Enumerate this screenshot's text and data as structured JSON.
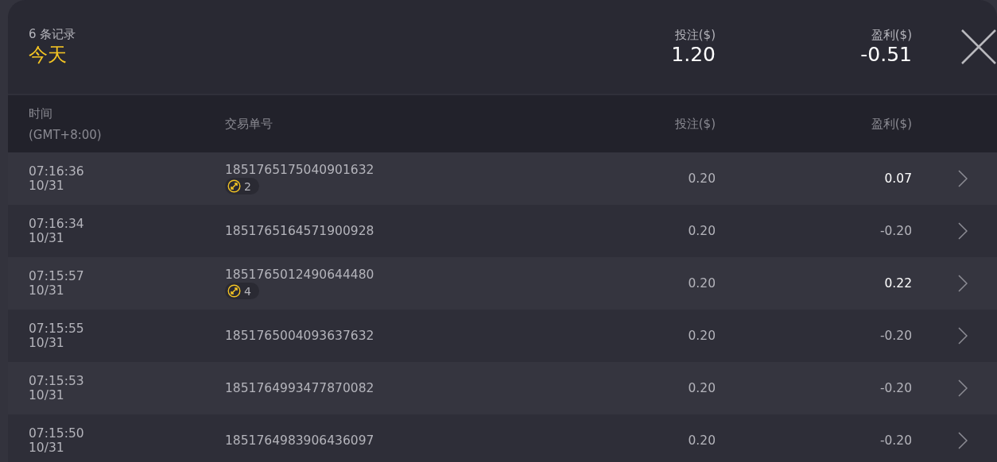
{
  "summary": {
    "count": "6 条记录",
    "period": "今天",
    "bet_label": "投注($)",
    "bet_total": "1.20",
    "profit_label": "盈利($)",
    "profit_total": "-0.51"
  },
  "table": {
    "columns": [
      {
        "label": "时间",
        "sub": "(GMT+8:00)"
      },
      {
        "label": "交易单号"
      },
      {
        "label": "投注($)"
      },
      {
        "label": "盈利($)"
      }
    ],
    "rows": [
      {
        "time": "07:16:36",
        "date": "10/31",
        "order": "1851765175040901632",
        "badge": "2",
        "bet": "0.20",
        "profit": "0.07",
        "positive": true
      },
      {
        "time": "07:16:34",
        "date": "10/31",
        "order": "1851765164571900928",
        "bet": "0.20",
        "profit": "-0.20",
        "positive": false
      },
      {
        "time": "07:15:57",
        "date": "10/31",
        "order": "1851765012490644480",
        "badge": "4",
        "bet": "0.20",
        "profit": "0.22",
        "positive": true
      },
      {
        "time": "07:15:55",
        "date": "10/31",
        "order": "1851765004093637632",
        "bet": "0.20",
        "profit": "-0.20",
        "positive": false
      },
      {
        "time": "07:15:53",
        "date": "10/31",
        "order": "1851764993477870082",
        "bet": "0.20",
        "profit": "-0.20",
        "positive": false
      },
      {
        "time": "07:15:50",
        "date": "10/31",
        "order": "1851764983906436097",
        "bet": "0.20",
        "profit": "-0.20",
        "positive": false
      }
    ]
  }
}
